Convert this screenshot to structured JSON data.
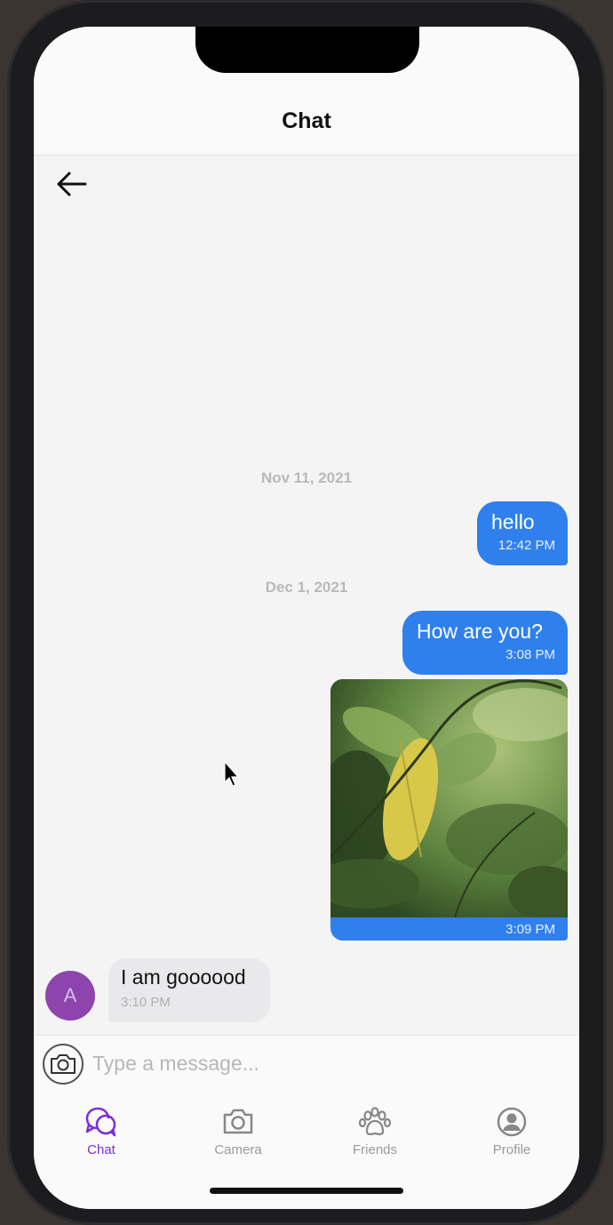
{
  "header": {
    "title": "Chat"
  },
  "messages": {
    "date_1": "Nov 11, 2021",
    "out_1": {
      "text": "hello",
      "time": "12:42 PM"
    },
    "date_2": "Dec 1, 2021",
    "out_2": {
      "text": "How are you?",
      "time": "3:08 PM"
    },
    "out_image": {
      "time": "3:09 PM",
      "content": "photo-leaves"
    },
    "in_1": {
      "avatar_initial": "A",
      "text": "I am goooood",
      "time": "3:10 PM"
    }
  },
  "composer": {
    "placeholder": "Type a message..."
  },
  "tabs": [
    {
      "label": "Chat",
      "icon": "chat-bubbles-icon",
      "active": true
    },
    {
      "label": "Camera",
      "icon": "camera-icon",
      "active": false
    },
    {
      "label": "Friends",
      "icon": "paw-icon",
      "active": false
    },
    {
      "label": "Profile",
      "icon": "profile-icon",
      "active": false
    }
  ],
  "colors": {
    "accent_blue": "#2f80ed",
    "active_tab": "#7b2fd6",
    "avatar_bg": "#8e44ad"
  }
}
